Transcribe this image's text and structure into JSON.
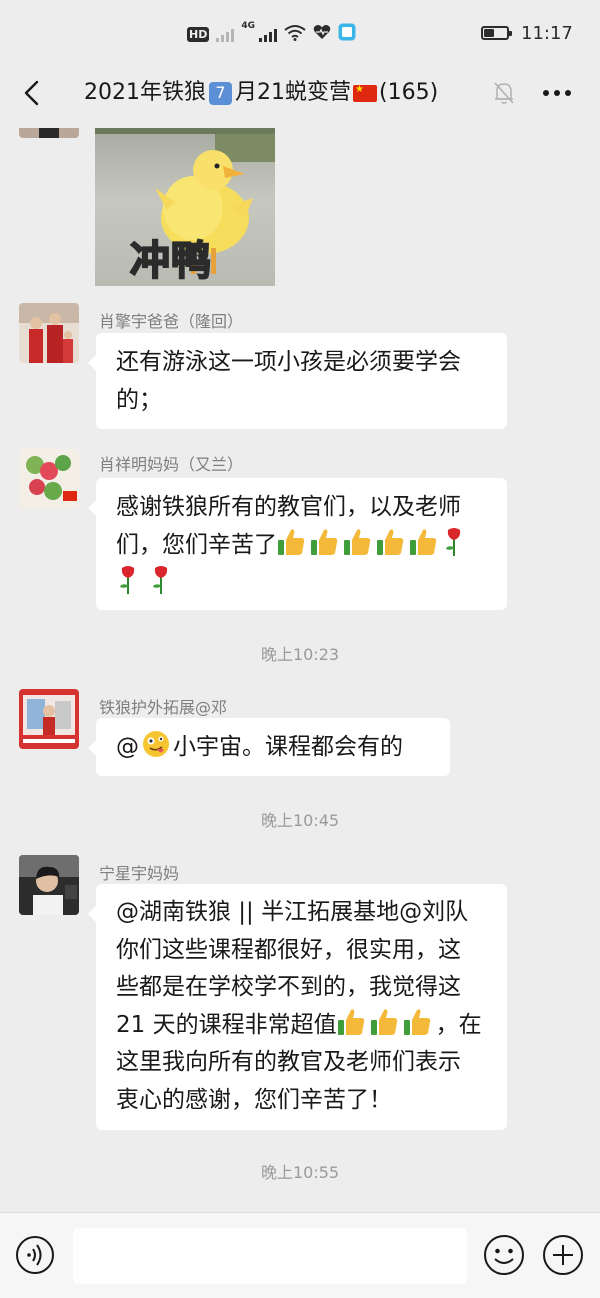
{
  "status_bar": {
    "hd_label": "HD",
    "network_label": "4G",
    "time": "11:17",
    "battery_level": 0.45,
    "icons": [
      "hd-icon",
      "signal-icon",
      "wifi-icon",
      "heart-health-icon",
      "app-notification-icon",
      "battery-icon"
    ]
  },
  "header": {
    "title_prefix": "2021年铁狼",
    "title_badge": "7",
    "title_middle": "月21蜕变营",
    "title_suffix": "(165)",
    "icons": [
      "back-icon",
      "mute-bell-icon",
      "more-icon"
    ]
  },
  "messages": [
    {
      "type": "sticker",
      "sticker_text": "冲鸭"
    },
    {
      "type": "text",
      "sender": "肖擎宇爸爸（隆回）",
      "lines": [
        "还有游泳这一项小孩是必须要学会",
        "的；"
      ]
    },
    {
      "type": "text",
      "sender": "肖祥明妈妈（又兰）",
      "lines": [
        "感谢铁狼所有的教官们，以及老师",
        "们，您们辛苦了"
      ],
      "emoji": [
        "thumbs-up",
        "thumbs-up",
        "thumbs-up",
        "thumbs-up",
        "thumbs-up",
        "rose",
        "rose",
        "rose"
      ]
    },
    {
      "type": "timestamp",
      "text": "晚上10:23"
    },
    {
      "type": "text",
      "sender": "铁狼护外拓展@邓",
      "prefix": "@",
      "text": "小宇宙。课程都会有的",
      "emoji": [
        "silly-face"
      ]
    },
    {
      "type": "timestamp",
      "text": "晚上10:45"
    },
    {
      "type": "text",
      "sender": "宁星宇妈妈",
      "lines": [
        "@湖南铁狼 || 半江拓展基地@刘队",
        "你们这些课程都很好，很实用，这",
        "些都是在学校学不到的，我觉得这",
        "21 天的课程非常超值",
        "，在",
        "这里我向所有的教官及老师们表示",
        "衷心的感谢，您们辛苦了！"
      ],
      "emoji": [
        "thumbs-up",
        "thumbs-up",
        "thumbs-up"
      ]
    },
    {
      "type": "timestamp",
      "text": "晚上10:55"
    }
  ],
  "input_bar": {
    "placeholder": "",
    "icons": [
      "voice-icon",
      "emoji-icon",
      "plus-icon"
    ]
  },
  "colors": {
    "background": "#ededed",
    "bubble": "#ffffff",
    "meta_text": "#7f7f7f",
    "thumb": "#f5b93a",
    "rose": "#d8262b"
  }
}
